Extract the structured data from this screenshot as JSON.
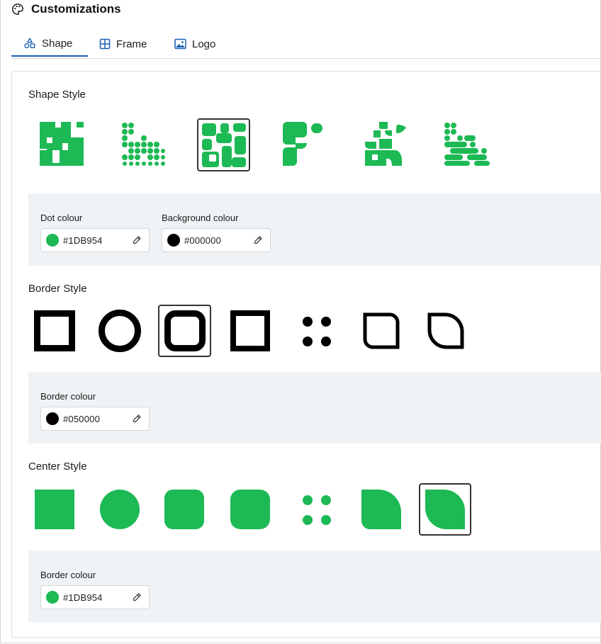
{
  "header": {
    "title": "Customizations",
    "icon": "palette-icon"
  },
  "tabs": [
    {
      "label": "Shape",
      "icon": "shapes-icon",
      "active": true
    },
    {
      "label": "Frame",
      "icon": "frame-grid-icon",
      "active": false
    },
    {
      "label": "Logo",
      "icon": "image-icon",
      "active": false
    }
  ],
  "shape_style": {
    "title": "Shape Style",
    "options": [
      "square-pixels",
      "dots",
      "rounded",
      "blob",
      "leaf",
      "rounded-dots"
    ],
    "selected_index": 2,
    "dot_colour_label": "Dot colour",
    "dot_colour": "#1DB954",
    "background_colour_label": "Background colour",
    "background_colour": "#000000"
  },
  "border_style": {
    "title": "Border Style",
    "options": [
      "square",
      "circle",
      "rounded-square",
      "square-thin",
      "dots",
      "rounded-corner",
      "leaf"
    ],
    "selected_index": 2,
    "colour_label": "Border colour",
    "colour": "#050000"
  },
  "center_style": {
    "title": "Center Style",
    "options": [
      "square",
      "circle",
      "rounded-square",
      "rounded-square-large",
      "dots",
      "leaf-left",
      "leaf-right"
    ],
    "selected_index": 6,
    "colour_label": "Border colour",
    "colour": "#1DB954"
  },
  "colors": {
    "accent": "#1DB954",
    "tab_active": "#1A5FB4",
    "panel_bg": "#F0F3F5"
  }
}
